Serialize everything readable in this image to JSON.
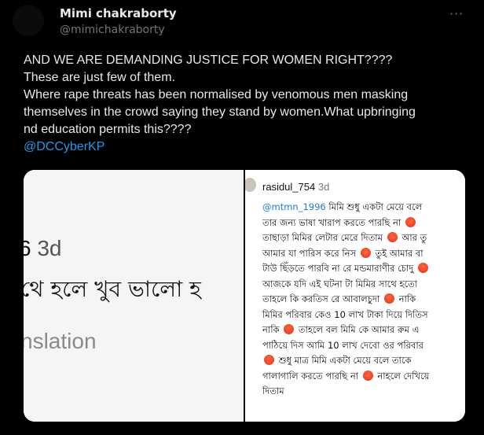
{
  "author": {
    "name": "Mimi chakraborty",
    "handle": "@mimichakraborty"
  },
  "more_label": "···",
  "post_lines": [
    "AND WE ARE DEMANDING JUSTICE FOR WOMEN RIGHT????",
    "These are just few of them.",
    "Where rape threats has been normalised by venomous men masking",
    "themselves in the crowd saying they stand by women.What upbringing",
    "nd education permits this????"
  ],
  "post_mention": "@DCCyberKP",
  "media": {
    "left": {
      "number": "6",
      "time": "3d",
      "bengali": "থে হলে খুব ভালো হ",
      "translation": "nslation"
    },
    "right": {
      "username": "rasidul_754",
      "time": "3d",
      "mention": "@mtmn_1996",
      "lines": [
        "মিমি শুধু একটা মেয়ে বলে",
        "তার জন্য ভাষা খারাপ করতে পারছি না",
        "তাছাড়া মিমির লেটার মেরে দিতাম",
        "আর তু",
        "আমার যা পারিস করে নিস",
        "তুই আমার বা",
        "টাউ ছিঁড়তে পারবি না রে মন্ডমারাণীর চোদু",
        "আজকে যদি এই ঘটনা টা মিমির সাথে হতো",
        "তাহলে কি করতিস রে আবালচুদা",
        "নাকি",
        "মিমির পরিবার কেও 10 লাখ টাকা দিয়ে দিতিস",
        "নাকি",
        "তাহলে বল মিমি কে আমার রুম এ",
        "পাঠিয়ে দিস আমি 10 লাখ দেবো ওর পরিবার",
        "শুধু মাত্র মিমি একটা মেয়ে বলে তাকে",
        "গালাগালি করতে পারছি না",
        "নাহলে দেখিয়ে",
        "দিতাম"
      ]
    }
  },
  "colors": {
    "background": "#000000",
    "link": "#1d9bf0",
    "muted": "#71767b",
    "emoji": "angry-face"
  }
}
